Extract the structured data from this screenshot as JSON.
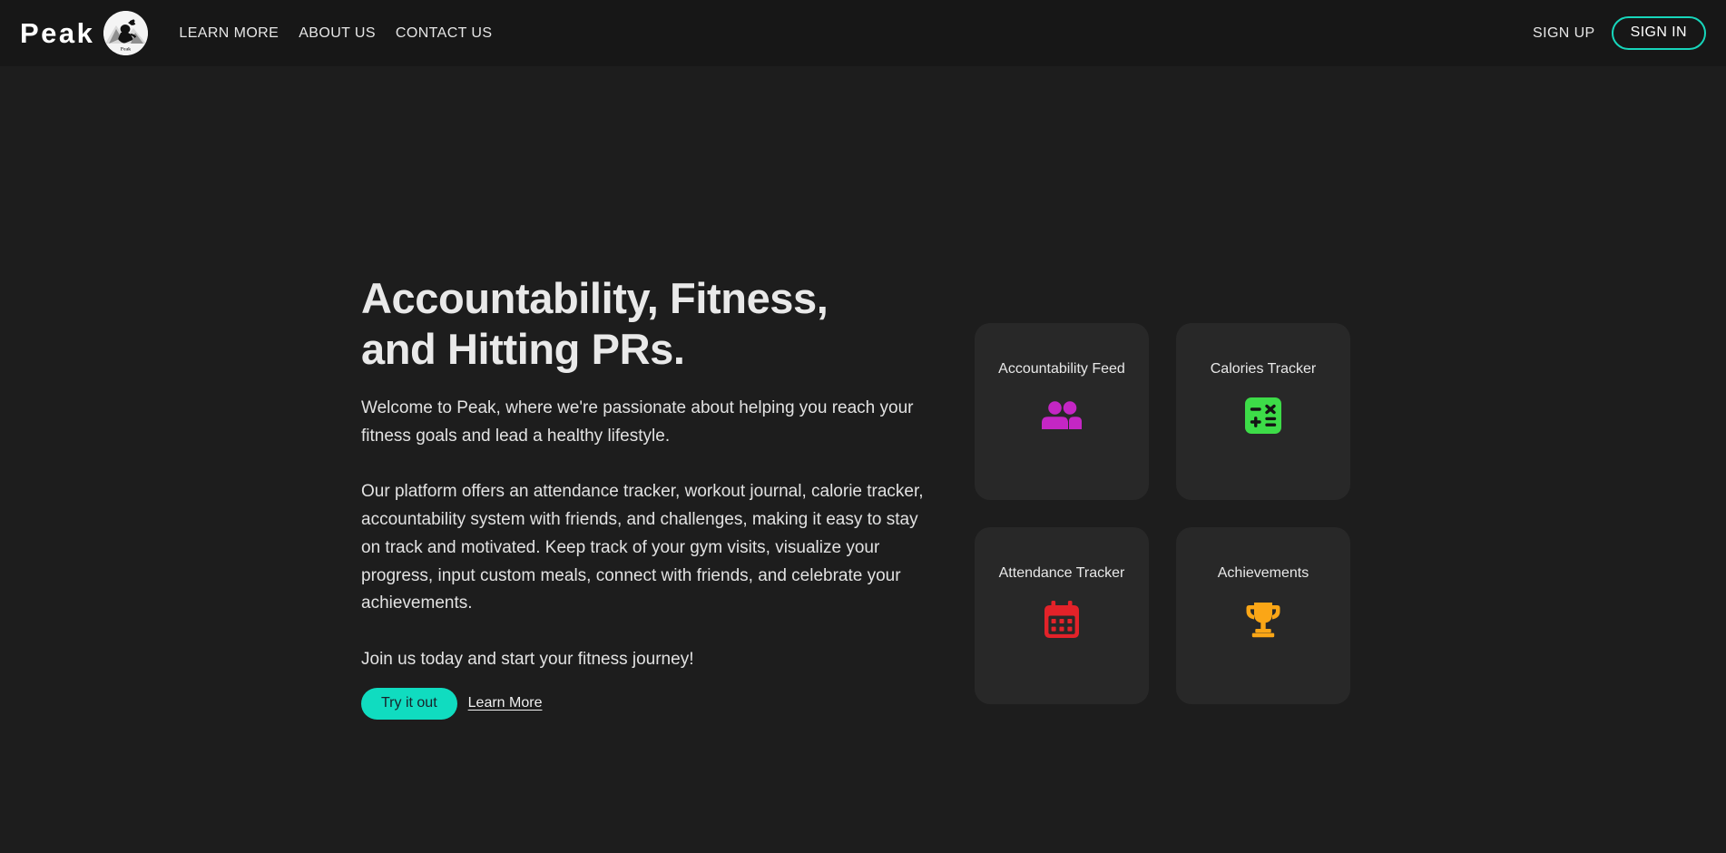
{
  "header": {
    "brand_word": "Peak",
    "brand_mark_icon": "peak-mountain-climber-logo",
    "brand_mark_caption": "Peak",
    "nav": [
      {
        "label": "LEARN MORE"
      },
      {
        "label": "ABOUT US"
      },
      {
        "label": "CONTACT US"
      }
    ],
    "sign_up_label": "SIGN UP",
    "sign_in_label": "SIGN IN",
    "background": "#171717",
    "accent": "#17d6bb"
  },
  "hero": {
    "title_line1": "Accountability, Fitness,",
    "title_line2": "and Hitting PRs.",
    "paragraph1": "Welcome to Peak, where we're passionate about helping you reach your fitness goals and lead a healthy lifestyle.",
    "paragraph2": "Our platform offers an attendance tracker, workout journal, calorie tracker, accountability system with friends, and challenges, making it easy to stay on track and motivated. Keep track of your gym visits, visualize your progress, input custom meals, connect with friends, and celebrate your achievements.",
    "paragraph3": "Join us today and start your fitness journey!",
    "primary_cta": "Try it out",
    "secondary_cta": "Learn More",
    "primary_cta_color": "#10dcc0"
  },
  "cards": [
    {
      "title": "Accountability Feed",
      "icon": "people-group-icon",
      "icon_color": "#c426c4"
    },
    {
      "title": "Calories Tracker",
      "icon": "calculator-icon",
      "icon_color": "#3ddc48"
    },
    {
      "title": "Attendance Tracker",
      "icon": "calendar-icon",
      "icon_color": "#e32229"
    },
    {
      "title": "Achievements",
      "icon": "trophy-icon",
      "icon_color": "#fba616"
    }
  ],
  "page": {
    "background": "#1d1d1d",
    "card_background": "#282828"
  }
}
